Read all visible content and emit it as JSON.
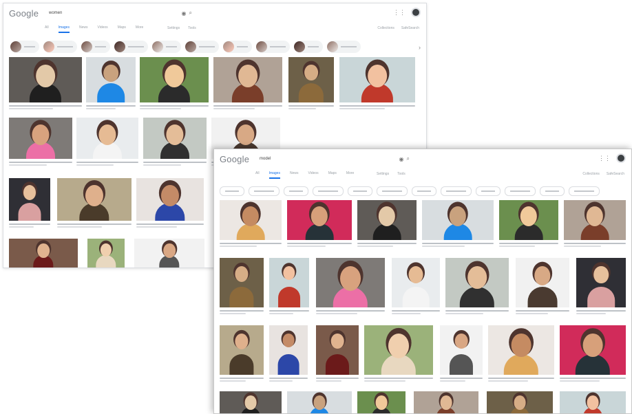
{
  "back_window": {
    "logo": "Google",
    "query": "women",
    "tabs": [
      "All",
      "Images",
      "News",
      "Videos",
      "Maps",
      "More"
    ],
    "active_tab": 1,
    "tools": [
      "Settings",
      "Tools"
    ],
    "right_links": [
      "Collections",
      "SafeSearch"
    ],
    "chips": [
      "",
      "",
      "",
      "",
      "",
      "",
      "",
      "",
      "",
      ""
    ]
  },
  "front_window": {
    "logo": "Google",
    "query": "model",
    "tabs": [
      "All",
      "Images",
      "News",
      "Videos",
      "Maps",
      "More"
    ],
    "active_tab": 1,
    "tools": [
      "Settings",
      "Tools"
    ],
    "right_links": [
      "Collections",
      "SafeSearch"
    ],
    "chips": [
      "",
      "",
      "",
      "",
      "",
      "",
      "",
      "",
      "",
      "",
      "",
      ""
    ]
  }
}
